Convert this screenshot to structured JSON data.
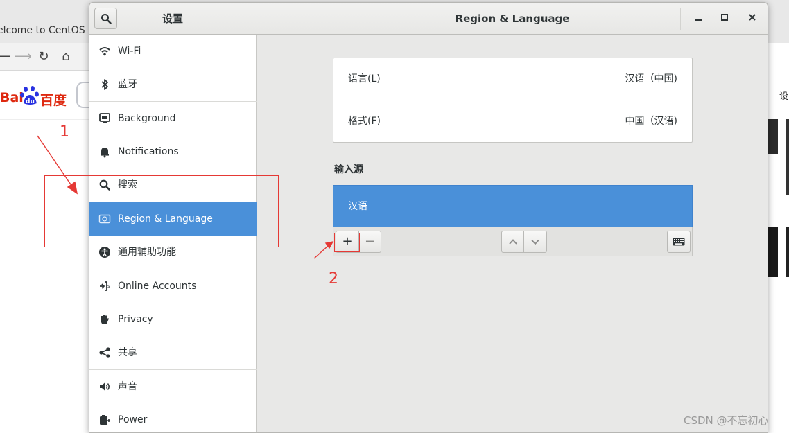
{
  "background_browser": {
    "tab_title": "elcome to CentOS",
    "logo_text": "Bai",
    "logo_text_cn": "百度",
    "logo_du": "du",
    "right_edge_text": "设"
  },
  "window": {
    "search_icon": "search-icon",
    "sidebar_title": "设置",
    "title": "Region & Language",
    "controls": {
      "minimize": "—",
      "maximize": "□",
      "close": "✕"
    }
  },
  "sidebar": {
    "items": [
      {
        "label": "Wi-Fi",
        "icon": "wifi-icon"
      },
      {
        "label": "蓝牙",
        "icon": "bluetooth-icon"
      },
      {
        "label": "Background",
        "icon": "background-icon"
      },
      {
        "label": "Notifications",
        "icon": "bell-icon"
      },
      {
        "label": "搜索",
        "icon": "search-icon"
      },
      {
        "label": "Region & Language",
        "icon": "region-flag-icon",
        "selected": true
      },
      {
        "label": "通用辅助功能",
        "icon": "accessibility-icon"
      },
      {
        "label": "Online Accounts",
        "icon": "online-accounts-icon"
      },
      {
        "label": "Privacy",
        "icon": "hand-icon"
      },
      {
        "label": "共享",
        "icon": "share-icon"
      },
      {
        "label": "声音",
        "icon": "speaker-icon"
      },
      {
        "label": "Power",
        "icon": "power-icon"
      }
    ]
  },
  "main": {
    "language_row": {
      "label": "语言(L)",
      "value": "汉语（中国)"
    },
    "format_row": {
      "label": "格式(F)",
      "value": "中国（汉语)"
    },
    "input_sources_heading": "输入源",
    "input_sources": [
      {
        "label": "汉语",
        "selected": true
      }
    ],
    "toolbar": {
      "add": "+",
      "remove": "−"
    }
  },
  "annotations": {
    "label_1": "1",
    "label_2": "2"
  },
  "watermark": "CSDN @不忘初心",
  "colors": {
    "accent": "#4a90d9",
    "annotation": "#e53935",
    "window_bg": "#e8e8e7"
  }
}
